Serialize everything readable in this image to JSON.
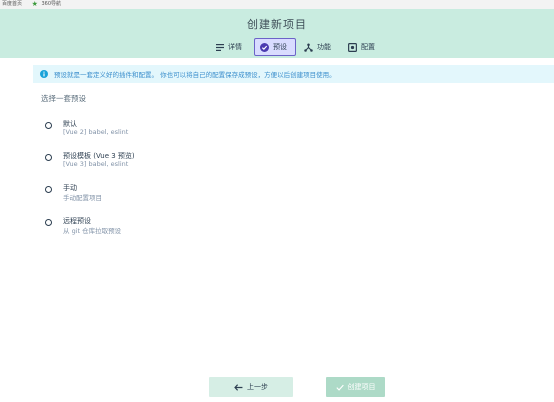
{
  "browser": {
    "bookmarks": [
      {
        "label": "百度首页"
      },
      {
        "label": "360导航"
      }
    ]
  },
  "header": {
    "title": "创建新项目",
    "tabs": [
      {
        "label": "详情",
        "icon": "list-icon",
        "active": false
      },
      {
        "label": "预设",
        "icon": "check-circle-icon",
        "active": true
      },
      {
        "label": "功能",
        "icon": "fork-icon",
        "active": false
      },
      {
        "label": "配置",
        "icon": "settings-box-icon",
        "active": false
      }
    ]
  },
  "info": {
    "text": "预设就是一套定义好的插件和配置。 你也可以将自己的配置保存成预设，方便以后创建项目使用。"
  },
  "presets": {
    "title": "选择一套预设",
    "options": [
      {
        "name": "默认",
        "desc": "[Vue 2] babel, eslint"
      },
      {
        "name": "预设模板 (Vue 3 预览)",
        "desc": "[Vue 3] babel, eslint"
      },
      {
        "name": "手动",
        "desc": "手动配置项目"
      },
      {
        "name": "远程预设",
        "desc": "从 git 仓库拉取预设"
      }
    ]
  },
  "footer": {
    "prev_label": "上一步",
    "create_label": "创建项目"
  },
  "colors": {
    "header_bg": "#c9ece0",
    "active_tab_bg": "#d9dcff",
    "active_tab_border": "#6c63c8",
    "info_bg": "#e3f7fc",
    "info_text": "#3a8ecc",
    "create_button_bg": "#addac7"
  }
}
